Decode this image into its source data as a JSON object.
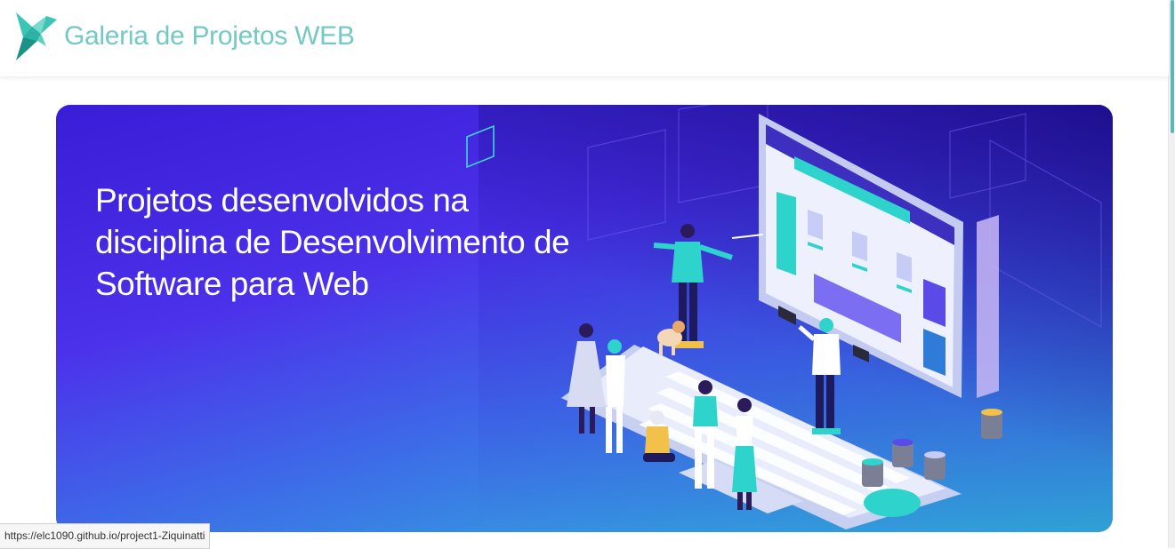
{
  "header": {
    "title": "Galeria de Projetos WEB",
    "logo_icon": "origami-bird-icon",
    "logo_colors": [
      "#1fa598",
      "#3cc4b4",
      "#7ad8cf"
    ]
  },
  "hero": {
    "heading": "Projetos desenvolvidos na disciplina de Desenvolvimento de Software para Web",
    "illustration": "people-building-website-on-laptop-illustration",
    "gradient_colors": [
      "#3a1dd6",
      "#4c31ea",
      "#2fc0d9"
    ]
  },
  "status_bar": {
    "url": "https://elc1090.github.io/project1-Ziquinatti"
  },
  "colors": {
    "brand": "#74c9c3",
    "accent_teal": "#2ed3cc"
  }
}
